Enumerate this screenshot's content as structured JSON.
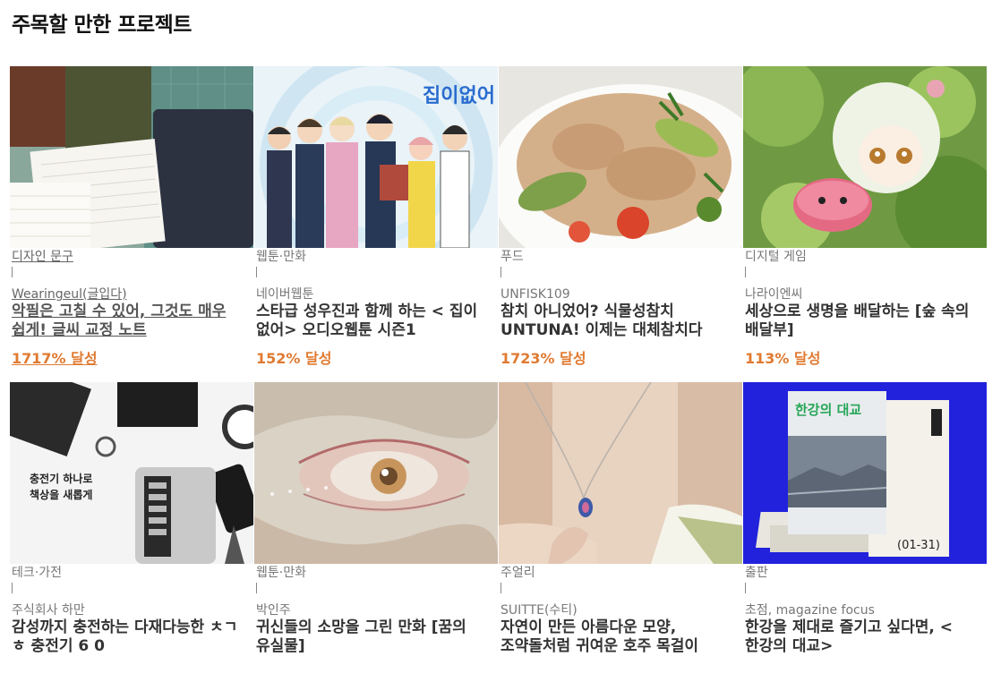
{
  "section": {
    "title": "주목할 만한 프로젝트"
  },
  "projects": [
    {
      "category": "디자인 문구",
      "creator": "Wearingeul(글입다)",
      "title": "악필은 고칠 수 있어, 그것도 매우 쉽게! 글씨 교정 노트",
      "achievement": "1717% 달성",
      "image": "stationery-notebooks",
      "hovered": true
    },
    {
      "category": "웹툰·만화",
      "creator": "네이버웹툰",
      "title": "스타급 성우진과 함께 하는 < 집이 없어> 오디오웹툰 시즌1",
      "achievement": "152% 달성",
      "image": "webtoon-characters"
    },
    {
      "category": "푸드",
      "creator": "UNFISK109",
      "title": "참치 아니었어? 식물성참치 UNTUNA! 이제는 대체참치다",
      "achievement": "1723% 달성",
      "image": "tuna-salad"
    },
    {
      "category": "디지털 게임",
      "creator": "나라이엔씨",
      "title": "세상으로 생명을 배달하는 [숲 속의 배달부]",
      "achievement": "113% 달성",
      "image": "anime-girl-forest"
    },
    {
      "category": "테크·가전",
      "creator": "주식회사 하만",
      "title": "감성까지 충전하는 다재다능한 ㅊㄱ ㅎ 충전기 6 0",
      "achievement": "",
      "image": "charger-desk",
      "image_text": [
        "충전기 하나로",
        "책상을 새롭게"
      ]
    },
    {
      "category": "웹툰·만화",
      "creator": "박인주",
      "title": "귀신들의 소망을 그린 만화 [꿈의 유실물]",
      "achievement": "",
      "image": "eye-illustration"
    },
    {
      "category": "주얼리",
      "creator": "SUITTE(수티)",
      "title": "자연이 만든 아름다운 모양, 조약돌처럼 귀여운 호주 목걸이",
      "achievement": "",
      "image": "opal-necklace"
    },
    {
      "category": "출판",
      "creator": "초점, magazine focus",
      "title": "한강을 제대로 즐기고 싶다면, <한강의 대교>",
      "achievement": "",
      "image": "magazine-books",
      "image_text": [
        "한강의 대교",
        "(01-31)"
      ]
    }
  ],
  "colors": {
    "achievement": "#e07a31",
    "category": "#777777",
    "title": "#333333",
    "magazine_blue": "#2222dd"
  }
}
